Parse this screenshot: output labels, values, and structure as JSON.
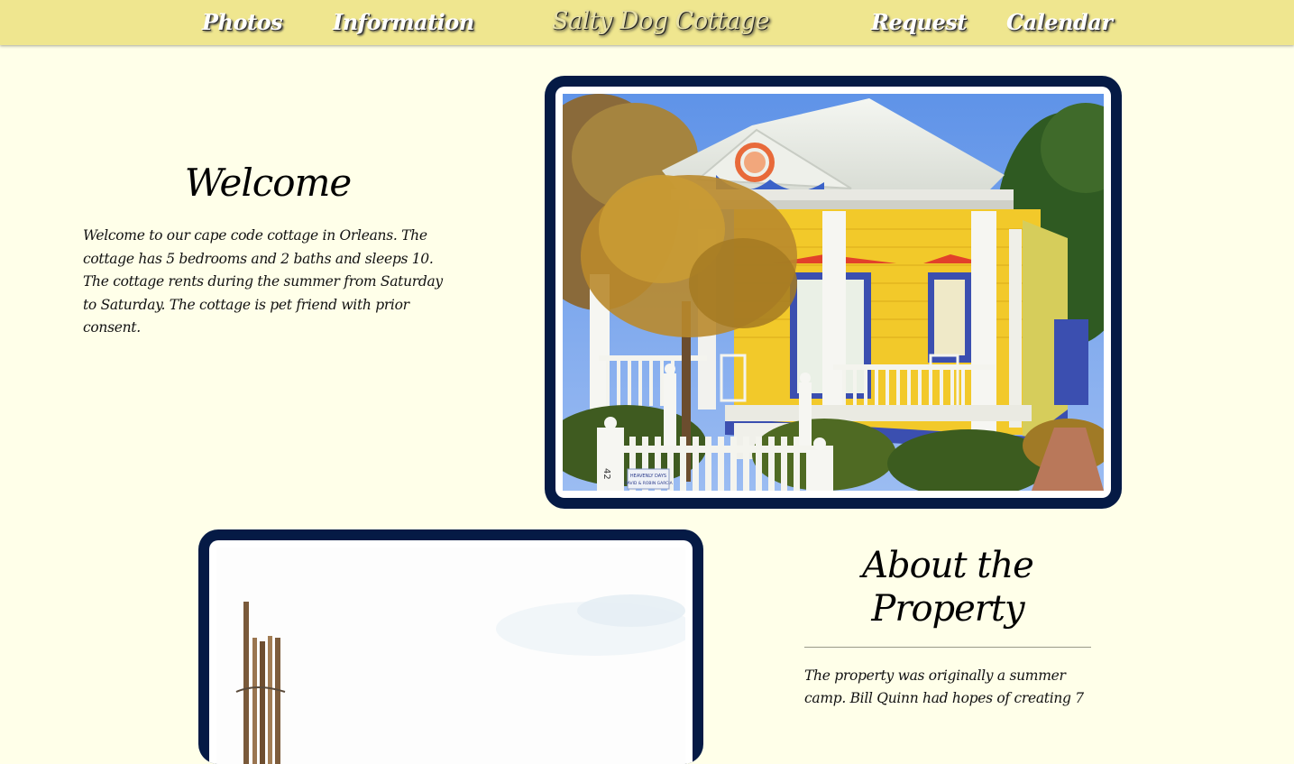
{
  "nav": {
    "items": [
      {
        "label": "Photos"
      },
      {
        "label": "Information"
      },
      {
        "label": "Request"
      },
      {
        "label": "Calendar"
      }
    ],
    "brand": "Salty Dog Cottage"
  },
  "welcome": {
    "heading": "Welcome",
    "body": "Welcome to our cape code cottage in Orleans. The cottage has 5 bedrooms and 2 baths and sleeps 10. The cottage rents during the summer from Saturday to Saturday. The cottage is pet friend with prior consent."
  },
  "about": {
    "heading_line1": "About the",
    "heading_line2": "Property",
    "body": "The property was originally a summer camp. Bill Quinn had hopes of creating 7"
  },
  "house_photo": {
    "sign_line1": "HEAVENLY DAYS",
    "sign_line2": "DAVID & ROBIN GARCIA",
    "post_number": "42"
  },
  "colors": {
    "page_background": "#ffffe9",
    "navbar": "#efe68f",
    "frame": "#051a45",
    "house_yellow": "#f2c92a",
    "trim_blue": "#3b4fb0"
  }
}
